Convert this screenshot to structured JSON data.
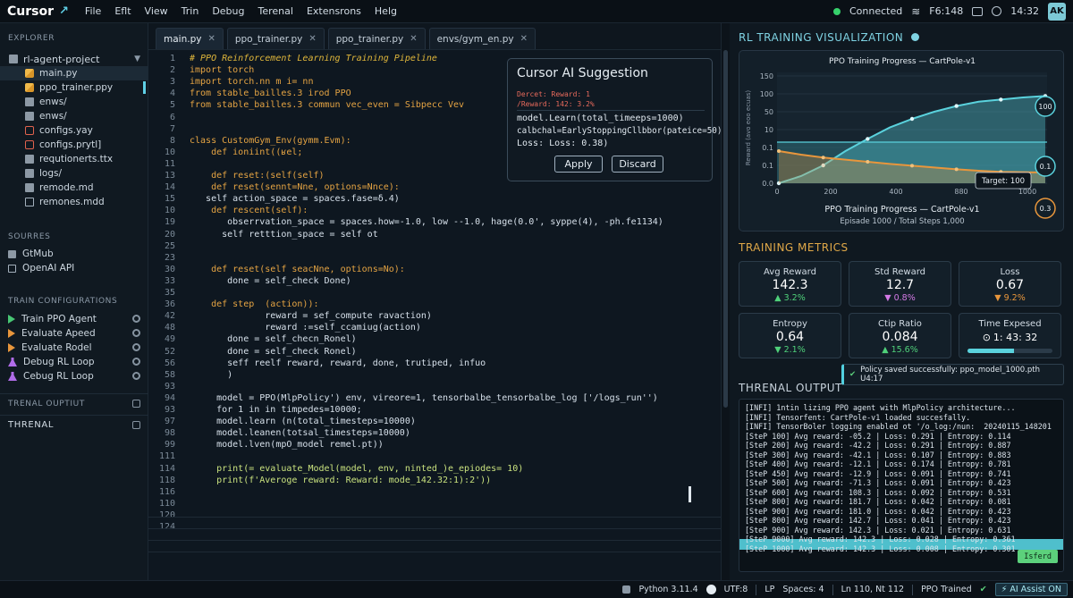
{
  "menubar": {
    "logo": "Cursor",
    "items": [
      "File",
      "Eflt",
      "View",
      "Trin",
      "Debug",
      "Terenal",
      "Extensrons",
      "Helg"
    ],
    "status": "Connected",
    "metric": "F6:148",
    "time": "14:32",
    "avatar": "AK"
  },
  "sidebar": {
    "explorer_title": "EXPLORER",
    "project": "rl-agent-project",
    "files": [
      "main.py",
      "ppo_trainer.ppy",
      "enws/",
      "enws/",
      "configs.yay",
      "configs.prytl]",
      "requtionerts.ttx",
      "logs/",
      "remode.md",
      "remones.mdd"
    ],
    "sources_title": "SOURRES",
    "sources": [
      "GtMub",
      "OpenAI API"
    ],
    "train_title": "TRAIN CONFIGURATIONS",
    "train_items": [
      "Train PPO Agent",
      "Evaluate Apeed",
      "Evaluate Rodel",
      "Debug RL Loop",
      "Cebug RL Loop"
    ],
    "section1": "TRENAL OUPTIUT",
    "section2": "THRENAL"
  },
  "tabs": [
    "main.py",
    "ppo_trainer.py",
    "ppo_trainer.py",
    "envs/gym_en.py"
  ],
  "editor": {
    "line_numbers": [
      "1",
      "2",
      "3",
      "4",
      "5",
      "6",
      "7",
      "8",
      "10",
      "11",
      "13",
      "14",
      "15",
      "10",
      "19",
      "20",
      "25",
      "23",
      "30",
      "33",
      "35",
      "36",
      "42",
      "48",
      "49",
      "52",
      "56",
      "58",
      "93",
      "94",
      "93",
      "97",
      "98",
      "99",
      "111",
      "114",
      "118",
      "116",
      "110",
      "120",
      "124"
    ],
    "lines": [
      "# PPO Reinforcement Learning Training Pipeline",
      "import torch",
      "import torch.nn m i= nn",
      "from stable_bailles.3 irod PPO",
      "from stable_bailles.3 commun vec_even = Sibpecc Vev",
      "",
      "",
      "class CustomGym_Env(gymm.Evm):",
      "    def ioniint((ʁel;",
      "",
      "    def reset:(self(self)",
      "    def reset(sennt=Nne, options=Nnce):",
      "   self action_space = spaces.fase=δ.4)",
      "    def rescent(self):",
      "       obserrvation_space = spaces.how=-1.0, low --1.0, hage(0.0', syppe(4), -ph.fe1134)",
      "      self retttion_space = self ot",
      "",
      "",
      "    def reset(self seacNne, options=No):",
      "       done = self_check Done)",
      "",
      "    def step  (action)):",
      "              reward = sef_compute ravaction)",
      "              reward :=self_ccamiug(action)",
      "       done = self_checn_Ronel)",
      "       done = self_check Ronel)",
      "       seff reelf reward, reward, done, trutiped, infuo",
      "       )",
      "",
      "     model = PPO(MlpPolicy') env, vireore=1, tensorbalbe_tensorbalbe_log ['/logs_run'')",
      "     for 1 in in timpedes=10000;",
      "     model.learn (n(total_timesteps=10000)",
      "     model.leanen(totsal_timesteps=10000)",
      "     model.lven(mpO_model remel.pt))",
      "",
      "     print(= evaluate_Model(model, env, ninted_)e_epiodes= 10)",
      "     print(f'Averoge reward: Reward: mode_142.32:1):2'))"
    ]
  },
  "ai": {
    "title": "Cursor AI Suggestion",
    "line1": "Dercet: Reward: 1",
    "line2": "/Reward: 142: 3.2%",
    "code1": "model.Learn(total_timeeps=1000)",
    "code2": "calbchal=EarlyStoppingCllbbor(pateice=50)",
    "code3": "Loss: Loss: 0.38)",
    "apply": "Apply",
    "discard": "Discard"
  },
  "right": {
    "viz_title": "RL TRAINING VISUALIZATION",
    "metrics_title": "TRAINING METRICS",
    "terminal_title": "THRENAL OUTPUT",
    "toast": "Policy saved successfully: ppo_model_1000.pth  U4:17"
  },
  "chart_data": {
    "type": "line",
    "title": "PPO Training Progress — CartPole-v1",
    "subtitle": "PPO Training Progress — CartPole-v1",
    "caption": "Episade 1000 / Total Steps 1,000",
    "ylabel": "Reward (avo eoo ecuas)",
    "x_ticks": [
      "0",
      "200",
      "400",
      "880",
      "1000"
    ],
    "y_ticks": [
      "150",
      "100",
      "50",
      "10",
      "0.1",
      "0.1",
      "0.0"
    ],
    "series": [
      {
        "values": [
          0,
          10,
          25,
          45,
          62,
          78,
          90,
          100,
          108,
          114,
          117,
          120,
          122
        ],
        "color": "#5ad2dd"
      },
      {
        "values": [
          0.9,
          0.8,
          0.72,
          0.66,
          0.6,
          0.54,
          0.49,
          0.44,
          0.39,
          0.35,
          0.32,
          0.31,
          0.3
        ],
        "color": "#e8963c"
      }
    ],
    "badges": [
      "100",
      "0.1",
      "0.3"
    ],
    "target_label": "Target: 100"
  },
  "metrics": [
    {
      "label": "Avg Reward",
      "value": "142.3",
      "delta": "3.2%",
      "dir": "up"
    },
    {
      "label": "Std Reward",
      "value": "12.7",
      "delta": "0.8%",
      "dir": "down-pink"
    },
    {
      "label": "Loss",
      "value": "0.67",
      "delta": "9.2%",
      "dir": "down-orange"
    },
    {
      "label": "Entropy",
      "value": "0.64",
      "delta": "2.1%",
      "dir": "down-up"
    },
    {
      "label": "Ctip Ratio",
      "value": "0.084",
      "delta": "15.6%",
      "dir": "up"
    },
    {
      "label": "Time Expesed",
      "value": "1: 43: 32",
      "delta": "",
      "dir": "timer",
      "progress": 0.55
    }
  ],
  "terminal": [
    "[INFI] 1ntin lizing PPO agent with MlpPolicy architecture...",
    "[INFI] Tensorfent: CartPole-v1 loaded succesfally.",
    "[INFI] TensorBoler logging enabled ot '/o_log:/nun:  20240115_148201",
    "[SteP 100] Avg reward: -05.2 | Loss: 0.291 | Entropy: 0.114",
    "[SteP 200] Avg reward: -42.2 | Loss: 0.291 | Entropy: 0.887",
    "[SteP 300] Avg reward: -42.1 | Loss: 0.107 | Entropy: 0.883",
    "[SteP 400] Avg reward: -12.1 | Loss: 0.174 | Entropy: 0.781",
    "[SteP 450] Avg reward: -12.9 | Loss: 0.091 | Entropy: 0.741",
    "[SteP 500] Avg reward: -71.3 | Loss: 0.091 | Entropy: 0.423",
    "[SteP 600] Avg reward: 108.3 | Loss: 0.092 | Entropy: 0.531",
    "[SteP 800] Avg reward: 181.7 | Loss: 0.042 | Entropy: 0.081",
    "[SteP 900] Avg reward: 181.0 | Loss: 0.042 | Entropy: 0.423",
    "[SteP 800] Avg reward: 142.7 | Loss: 0.041 | Entropy: 0.423",
    "[SteP 900] Avg reward: 142.3 | Loss: 0.021 | Entropy: 0.631",
    "[SteP 9000] Avg reward: 142.3 | Loss: 0.028 | Entropy: 0.361",
    "[SteP 1000] Avg reward: 142.3 | Loss: 0.008 | Entropy: 0.301"
  ],
  "terminal_badge": "Isferd",
  "status": {
    "python": "Python 3.11.4",
    "encoding": "UTF:8",
    "lp": "LP",
    "spaces": "Spaces: 4",
    "position": "Ln 110, Nt 112",
    "trained": "PPO Trained",
    "ai_assist": "AI Assist ON"
  }
}
